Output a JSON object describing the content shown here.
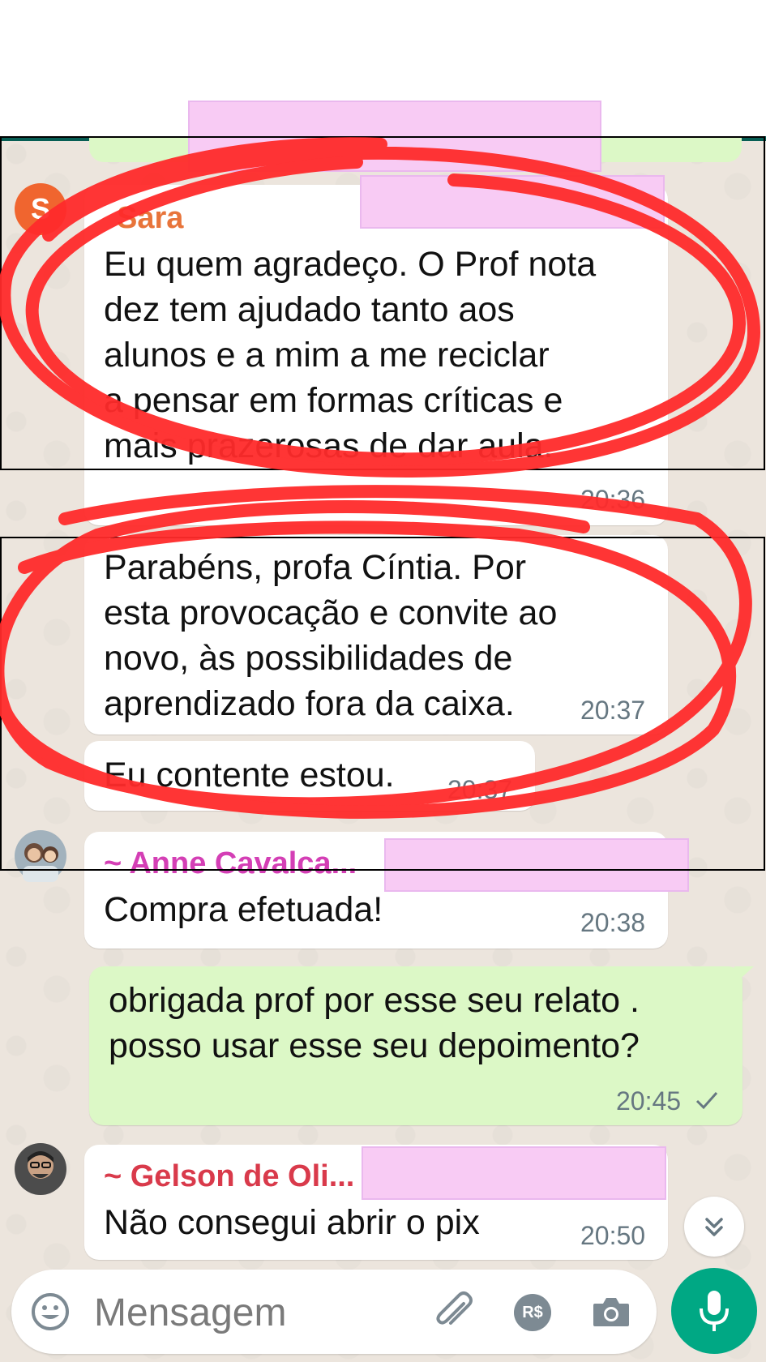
{
  "messages": [
    {
      "sender": "Sara",
      "text": "Eu quem agradeço. O Prof nota\ndez tem ajudado tanto aos\nalunos e a mim a me reciclar\na pensar em formas críticas e\nmais prazerosas de dar aula.",
      "time": "20:36",
      "avatar_initial": "S"
    },
    {
      "text": "Parabéns, profa Cíntia. Por\nesta provocação e convite ao\nnovo, às possibilidades de\naprendizado fora da caixa.",
      "time": "20:37"
    },
    {
      "text": "Eu contente estou.",
      "time": "20:37"
    },
    {
      "sender": "~ Anne Cavalca...",
      "text": "Compra efetuada!",
      "time": "20:38"
    },
    {
      "text": "obrigada prof por esse seu relato .\nposso usar esse seu depoimento?",
      "time": "20:45",
      "status_icon": "check-icon"
    },
    {
      "sender": "~ Gelson de Oli...",
      "text": "Não consegui abrir o pix",
      "time": "20:50"
    }
  ],
  "input": {
    "placeholder": "Mensagem"
  },
  "colors": {
    "outgoing_bubble": "#dcf8c6",
    "incoming_bubble": "#ffffff",
    "accent": "#00a884",
    "annotation_red": "#ff2b2b",
    "redaction": "#f8cbf4",
    "sender_sara": "#e8743a",
    "sender_anne": "#d43fb5",
    "sender_gelson": "#d93a4b"
  },
  "icons": [
    "emoji-icon",
    "attach-icon",
    "pix-payment-icon",
    "camera-icon",
    "mic-icon",
    "scroll-down-icon"
  ],
  "payment_icon_label": "R$"
}
